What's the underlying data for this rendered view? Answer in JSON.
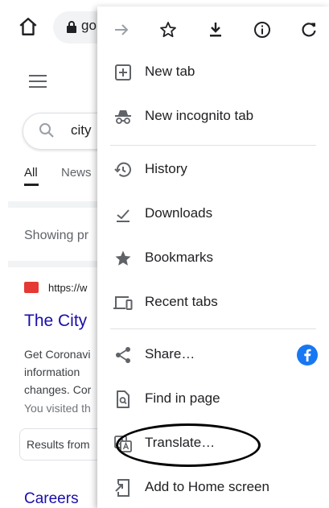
{
  "browser": {
    "url_fragment": "go",
    "search_query": "city"
  },
  "search_page": {
    "tabs": [
      "All",
      "News"
    ],
    "showing_text": "Showing pr",
    "result": {
      "url": "https://w",
      "title": "The City",
      "snippet_lines": [
        "Get Coronavi",
        "information",
        "changes. Cor"
      ],
      "visited_text": "You visited th"
    },
    "chip_text": "Results from",
    "careers_text": "Careers"
  },
  "menu": {
    "toolbar_icons": [
      "forward-icon",
      "star-icon",
      "download-icon",
      "info-icon",
      "reload-icon"
    ],
    "items": [
      {
        "label": "New tab",
        "icon": "new-tab-icon"
      },
      {
        "label": "New incognito tab",
        "icon": "incognito-icon"
      },
      {
        "label": "History",
        "icon": "history-icon"
      },
      {
        "label": "Downloads",
        "icon": "downloads-icon"
      },
      {
        "label": "Bookmarks",
        "icon": "bookmarks-icon"
      },
      {
        "label": "Recent tabs",
        "icon": "recent-tabs-icon"
      },
      {
        "label": "Share…",
        "icon": "share-icon"
      },
      {
        "label": "Find in page",
        "icon": "find-in-page-icon"
      },
      {
        "label": "Translate…",
        "icon": "translate-icon"
      },
      {
        "label": "Add to Home screen",
        "icon": "add-to-home-icon"
      }
    ]
  },
  "colors": {
    "link": "#1a0dab",
    "facebook": "#1877f2",
    "favicon": "#e53935"
  }
}
